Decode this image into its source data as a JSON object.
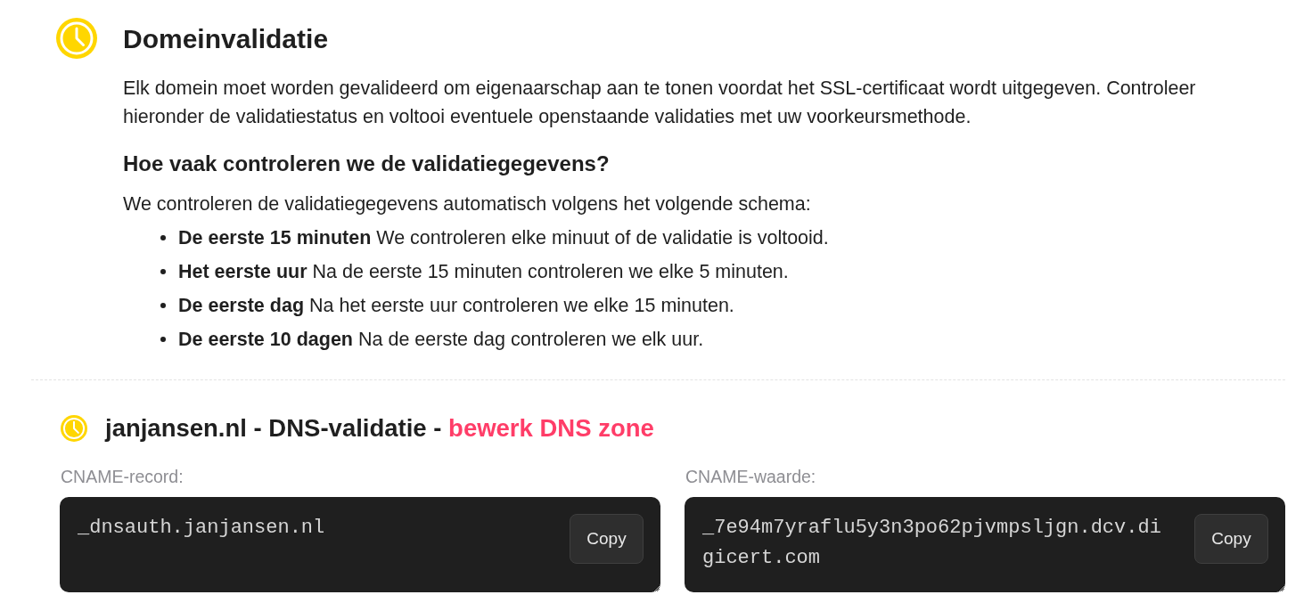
{
  "header": {
    "title": "Domeinvalidatie",
    "intro": "Elk domein moet worden gevalideerd om eigenaarschap aan te tonen voordat het SSL-certificaat wordt uitgegeven. Controleer hieronder de validatiestatus en voltooi eventuele openstaande validaties met uw voorkeursmethode.",
    "subheading": "Hoe vaak controleren we de validatiegegevens?",
    "schedule_intro": "We controleren de validatiegegevens automatisch volgens het volgende schema:",
    "schedule": [
      "**De eerste 15 minuten** We controleren elke minuut of de validatie is voltooid.",
      "**Het eerste uur** Na de eerste 15 minuten controleren we elke 5 minuten.",
      "**De eerste dag** Na het eerste uur controleren we elke 15 minuten.",
      "**De eerste 10 dagen** Na de eerste dag controleren we elk uur."
    ]
  },
  "validations": [
    {
      "title": "janjansen.nl - DNS-validatie -",
      "link": "bewerk DNS zone",
      "fields": [
        {
          "label": "CNAME-record:",
          "value": "_dnsauth.janjansen.nl",
          "button": "Copy"
        },
        {
          "label": "CNAME-waarde:",
          "value": "_7e94m7yraflu5y3n3po62pjvmpsljgn.dcv.digicert.com",
          "button": "Copy"
        }
      ]
    }
  ]
}
